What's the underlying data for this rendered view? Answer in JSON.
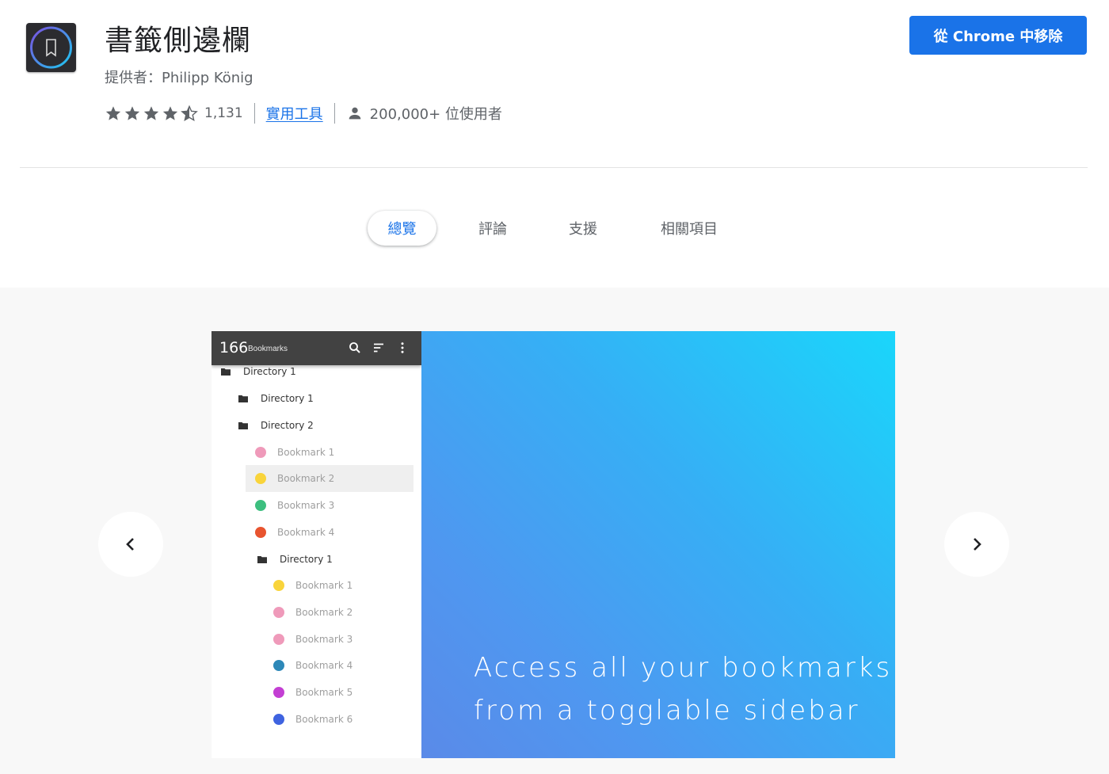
{
  "header": {
    "title": "書籤側邊欄",
    "provider": "提供者：Philipp König",
    "rating": 4.5,
    "rating_count": "1,131",
    "category": "實用工具",
    "users": "200,000+ 位使用者",
    "remove_button": "從 Chrome 中移除"
  },
  "tabs": [
    {
      "label": "總覽",
      "active": true
    },
    {
      "label": "評論",
      "active": false
    },
    {
      "label": "支援",
      "active": false
    },
    {
      "label": "相關項目",
      "active": false
    }
  ],
  "colors": {
    "accent": "#1a73e8",
    "sidebar_header": "#424242"
  },
  "screenshot": {
    "count": "166",
    "count_label": "Bookmarks",
    "tree": [
      {
        "type": "dir",
        "label": "Directory 1"
      },
      {
        "type": "dir",
        "label": "Directory 1"
      },
      {
        "type": "dir",
        "label": "Directory 2"
      },
      {
        "type": "bm",
        "label": "Bookmark 1",
        "color": "#ef9aba"
      },
      {
        "type": "bm",
        "label": "Bookmark 2",
        "color": "#f9d43b",
        "highlighted": true
      },
      {
        "type": "bm",
        "label": "Bookmark 3",
        "color": "#3dbf7f"
      },
      {
        "type": "bm",
        "label": "Bookmark 4",
        "color": "#e8542f"
      },
      {
        "type": "dir",
        "label": "Directory 1"
      },
      {
        "type": "bm",
        "label": "Bookmark 1",
        "color": "#f9d43b"
      },
      {
        "type": "bm",
        "label": "Bookmark 2",
        "color": "#ef9aba"
      },
      {
        "type": "bm",
        "label": "Bookmark 3",
        "color": "#ef9aba"
      },
      {
        "type": "bm",
        "label": "Bookmark 4",
        "color": "#2d88b8"
      },
      {
        "type": "bm",
        "label": "Bookmark 5",
        "color": "#c33fd3"
      },
      {
        "type": "bm",
        "label": "Bookmark 6",
        "color": "#3f63e0"
      }
    ],
    "caption_line1": "Access all your bookmarks",
    "caption_line2": "from a togglable sidebar"
  }
}
